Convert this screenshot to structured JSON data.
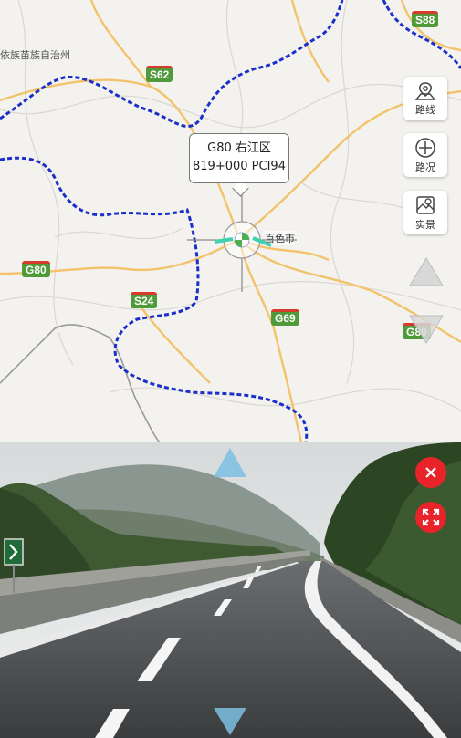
{
  "map": {
    "labels": {
      "autonomous_region": "依族苗族自治州",
      "city": "百色市"
    },
    "shields": {
      "s88": "S88",
      "s62": "S62",
      "g80_west": "G80",
      "s24": "S24",
      "g69": "G69",
      "g80_east": "G80"
    },
    "callout": {
      "line1": "G80 右江区",
      "line2": "819+000 PCI94"
    },
    "toolbar": {
      "route_label": "路线",
      "traffic_label": "路况",
      "live_label": "实景"
    },
    "colors": {
      "background": "#f3f2ee",
      "highway": "#f3c36b",
      "boundary": "#1a2fc9",
      "shield_green": "#4f9a3a"
    }
  },
  "camera": {
    "colors": {
      "close_button": "#e8232a",
      "nav_arrow": "#7bbfe0"
    }
  }
}
